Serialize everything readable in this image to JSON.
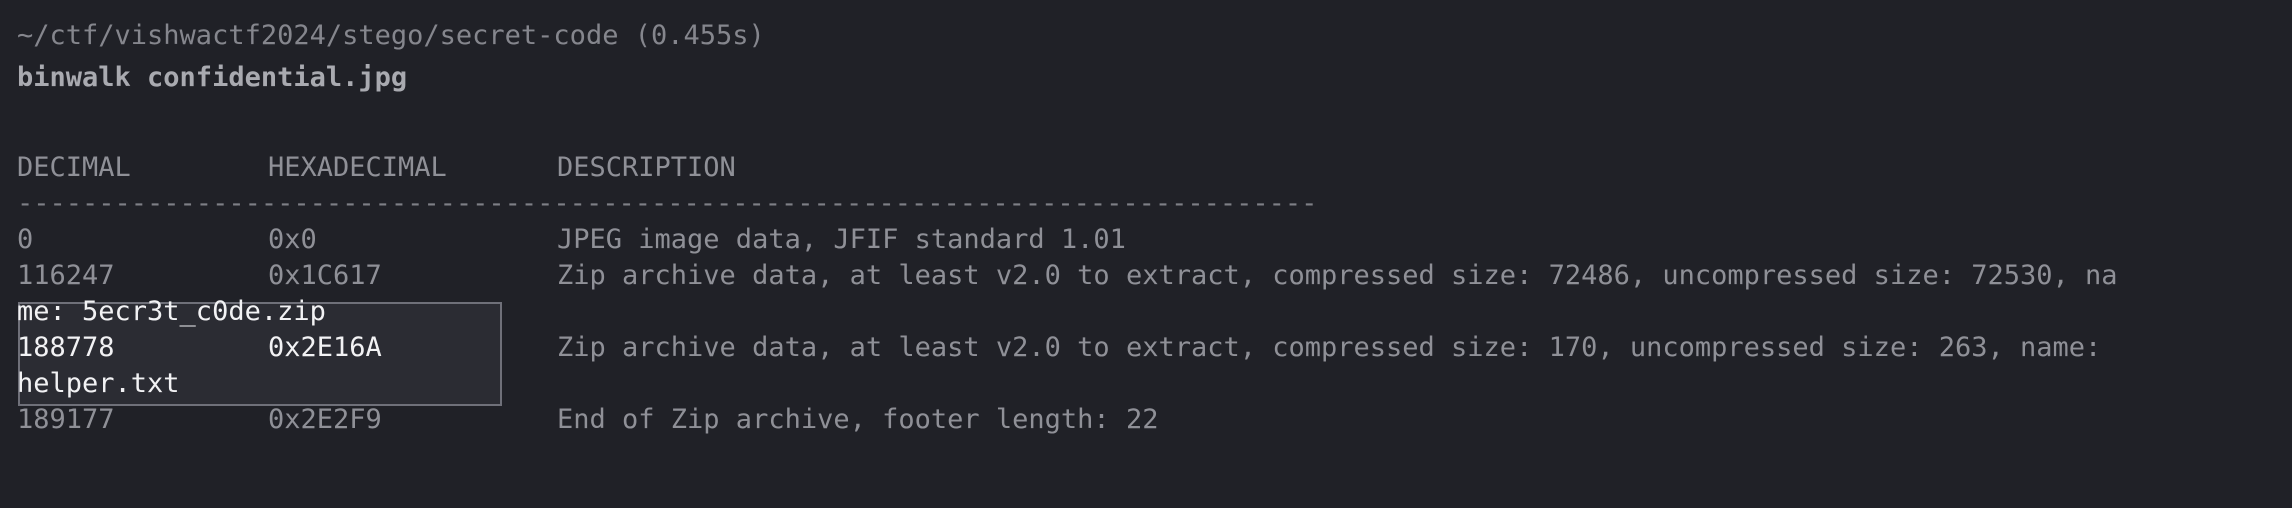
{
  "terminal": {
    "path_line": "~/ctf/vishwactf2024/stego/secret-code (0.455s)",
    "command": "binwalk confidential.jpg",
    "columns": [
      "DECIMAL",
      "HEXADECIMAL",
      "DESCRIPTION"
    ],
    "divider": "--------------------------------------------------------------------------------",
    "rows": [
      {
        "decimal": "0",
        "hex": "0x0",
        "description": "JPEG image data, JFIF standard 1.01"
      },
      {
        "decimal": "116247",
        "hex": "0x1C617",
        "description": "Zip archive data, at least v2.0 to extract, compressed size: 72486, uncompressed size: 72530, na",
        "wrap": "me: 5ecr3t_c0de.zip"
      },
      {
        "decimal": "188778",
        "hex": "0x2E16A",
        "description": "Zip archive data, at least v2.0 to extract, compressed size: 170, uncompressed size: 263, name:",
        "wrap": "helper.txt"
      },
      {
        "decimal": "189177",
        "hex": "0x2E2F9",
        "description": "End of Zip archive, footer length: 22"
      }
    ]
  }
}
